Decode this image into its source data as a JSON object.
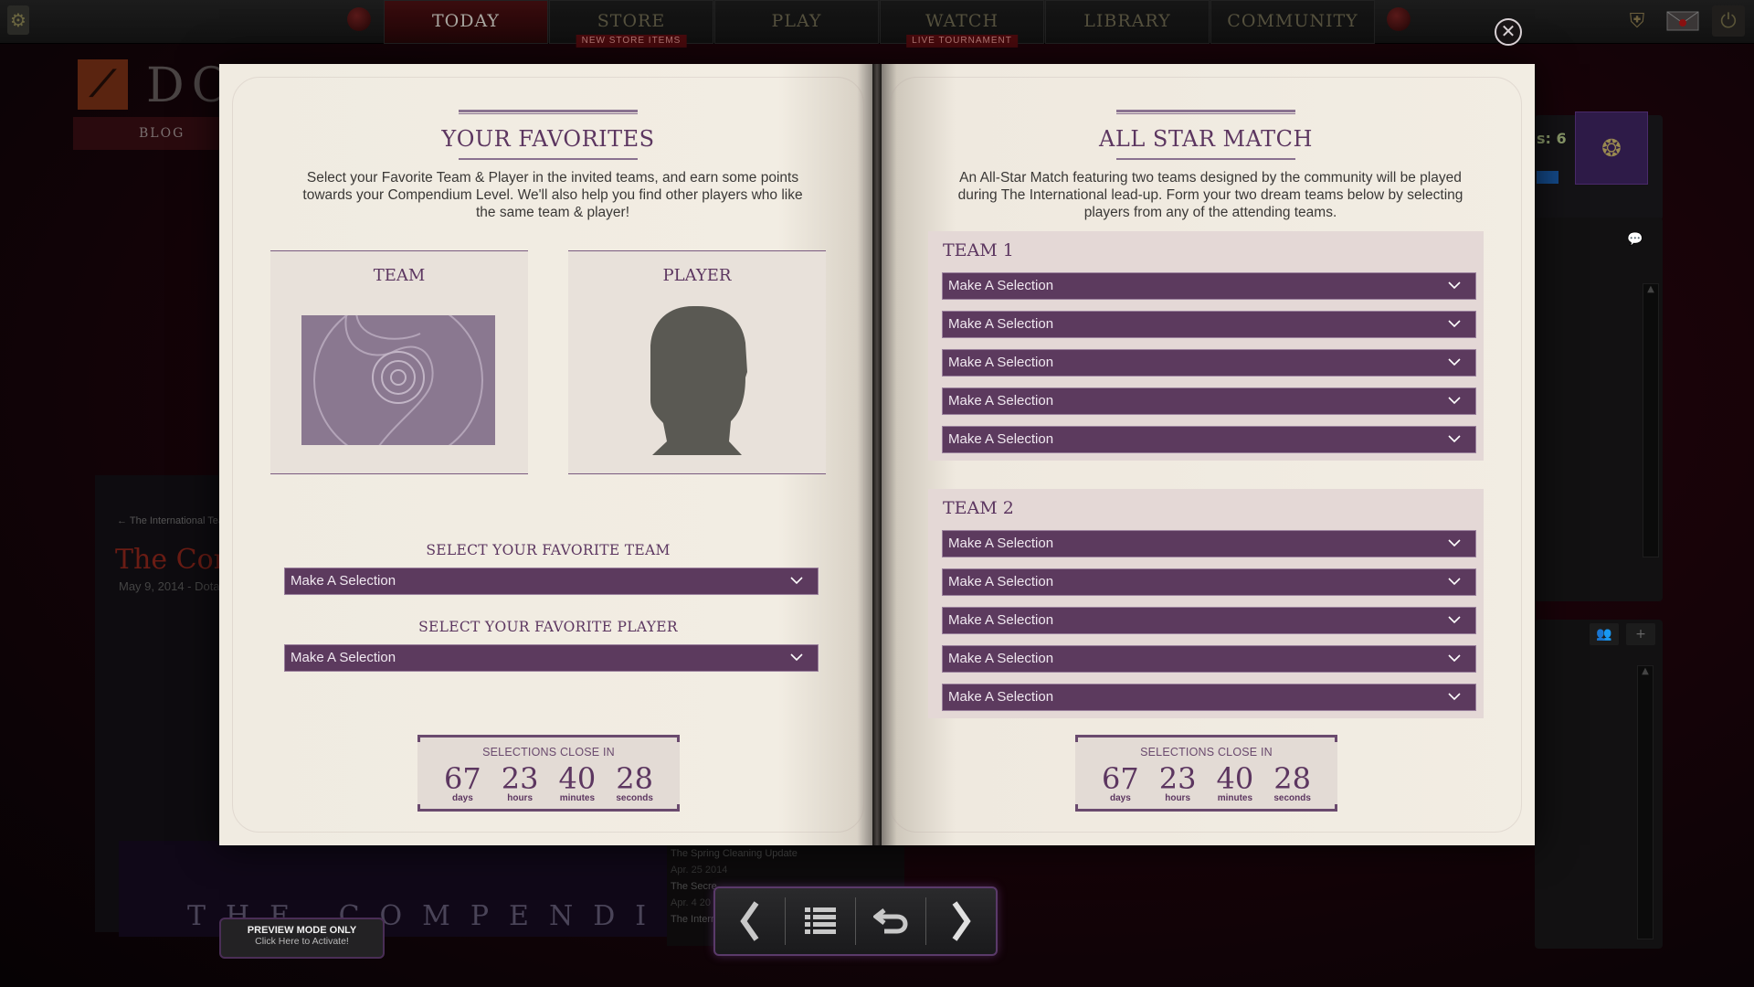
{
  "topbar": {
    "tabs": [
      {
        "label": "TODAY",
        "active": true,
        "badge": null
      },
      {
        "label": "STORE",
        "active": false,
        "badge": "NEW STORE ITEMS"
      },
      {
        "label": "PLAY",
        "active": false,
        "badge": null
      },
      {
        "label": "WATCH",
        "active": false,
        "badge": "LIVE TOURNAMENT"
      },
      {
        "label": "LIBRARY",
        "active": false,
        "badge": null
      },
      {
        "label": "COMMUNITY",
        "active": false,
        "badge": null
      }
    ],
    "icons": {
      "settings": "gear-icon",
      "battle_level": "shield-sword-icon",
      "mail": "envelope-icon",
      "power": "power-icon"
    }
  },
  "background": {
    "logo_word": "DO",
    "blog_label": "BLOG",
    "breadcrumb": "← The International Tea",
    "article_title": "The Com",
    "article_date": "May 9, 2014 - Dota",
    "compendium_title": "THE COMPENDIUM",
    "news": [
      {
        "title": "The Spring Cleaning Update",
        "date": "Apr. 25 2014"
      },
      {
        "title": "The Secre",
        "date": "Apr. 4 20"
      },
      {
        "title": "The Intern",
        "date": ""
      }
    ],
    "level_text": "s: 6"
  },
  "favorites": {
    "title": "YOUR FAVORITES",
    "description": "Select your Favorite Team & Player in the invited teams, and earn some points towards your Compendium Level. We'll also help you find other players who like the same team & player!",
    "team_card_label": "TEAM",
    "player_card_label": "PLAYER",
    "team_select_label": "SELECT YOUR FAVORITE TEAM",
    "team_select_value": "Make A Selection",
    "player_select_label": "SELECT YOUR FAVORITE PLAYER",
    "player_select_value": "Make A Selection",
    "countdown": {
      "title": "SELECTIONS CLOSE IN",
      "days": "67",
      "days_label": "days",
      "hours": "23",
      "hours_label": "hours",
      "minutes": "40",
      "minutes_label": "minutes",
      "seconds": "28",
      "seconds_label": "seconds"
    }
  },
  "allstar": {
    "title": "ALL STAR MATCH",
    "description": "An All-Star Match featuring two teams designed by the community will be played during The International lead-up. Form your two dream teams below by selecting players from any of the attending teams.",
    "team1": {
      "label": "TEAM 1",
      "slots": [
        "Make A Selection",
        "Make A Selection",
        "Make A Selection",
        "Make A Selection",
        "Make A Selection"
      ]
    },
    "team2": {
      "label": "TEAM 2",
      "slots": [
        "Make A Selection",
        "Make A Selection",
        "Make A Selection",
        "Make A Selection",
        "Make A Selection"
      ]
    },
    "countdown": {
      "title": "SELECTIONS CLOSE IN",
      "days": "67",
      "days_label": "days",
      "hours": "23",
      "hours_label": "hours",
      "minutes": "40",
      "minutes_label": "minutes",
      "seconds": "28",
      "seconds_label": "seconds"
    }
  },
  "close_button": {
    "icon": "close-circle-icon",
    "glyph": "✕"
  },
  "book_nav": {
    "prev_icon": "chevron-left-icon",
    "contents_icon": "list-icon",
    "back_icon": "return-arrow-icon",
    "next_icon": "chevron-right-icon"
  },
  "preview": {
    "title": "PREVIEW MODE ONLY",
    "subtitle": "Click Here to Activate!"
  },
  "colors": {
    "accent_purple": "#5c3660",
    "dropdown_bg": "#5c3a5e",
    "page_bg": "#f2ede3",
    "panel_bg": "#e4d8d6",
    "active_tab": "#3a0c0e"
  }
}
